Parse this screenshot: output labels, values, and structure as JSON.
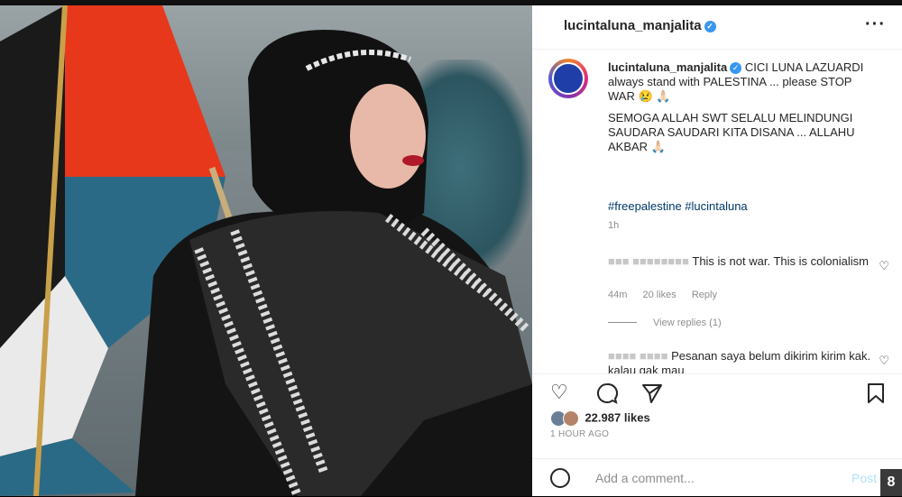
{
  "post": {
    "username": "lucintaluna_manjalita",
    "more_icon": "more-horizontal-icon"
  },
  "caption": {
    "username": "lucintaluna_manjalita",
    "line1": "CICI LUNA LAZUARDI always stand with PALESTINA ... please STOP WAR",
    "line2": "SEMOGA ALLAH SWT SELALU MELINDUNGI SAUDARA SAUDARI KITA DISANA ... ALLAHU AKBAR",
    "tags": "#freepalestine #lucintaluna",
    "time": "1h"
  },
  "comment1": {
    "text": "This is not war. This is colonialism",
    "time": "44m",
    "likes": "20 likes",
    "reply": "Reply",
    "view_replies": "View replies (1)"
  },
  "comment2": {
    "text": "Pesanan saya belum dikirim kirim kak. kalau gak mau"
  },
  "stats": {
    "likes": "22.987 likes",
    "ago": "1 HOUR AGO"
  },
  "composer": {
    "placeholder": "Add a comment...",
    "post_label": "Post"
  },
  "overlay": {
    "page_badge": "8"
  },
  "colors": {
    "link": "#00376b",
    "verified": "#3897f0",
    "flag_red": "#e8381c",
    "flag_blue": "#2b6a86",
    "flag_black": "#1a1a1a"
  }
}
